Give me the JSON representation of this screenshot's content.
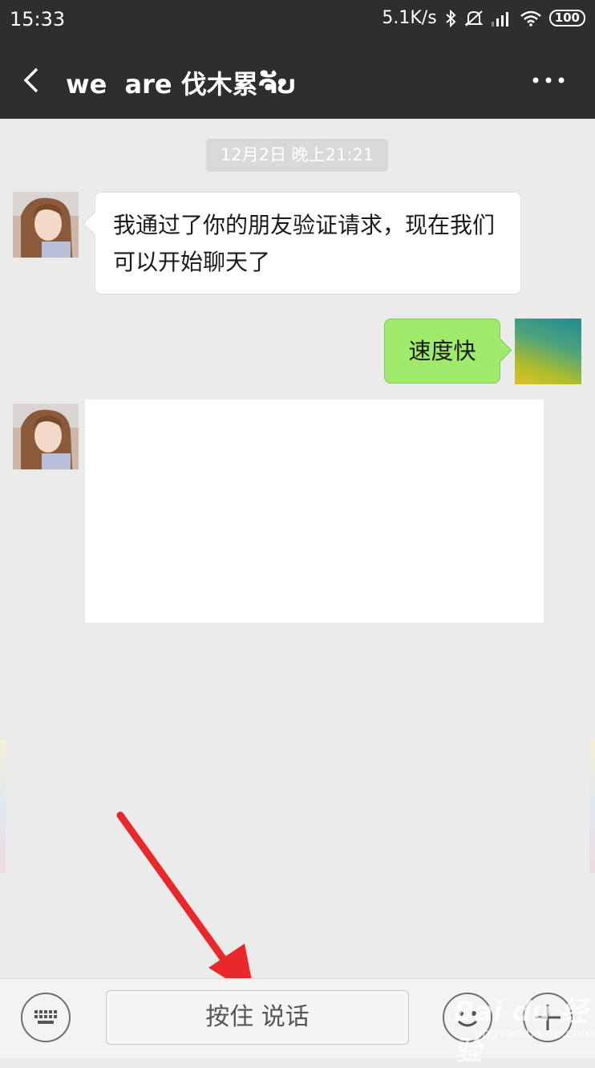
{
  "status_bar": {
    "time": "15:33",
    "network_speed": "5.1K/s",
    "battery": "100",
    "icons": [
      "bluetooth-icon",
      "mute-icon",
      "signal-icon",
      "wifi-icon",
      "battery-icon"
    ]
  },
  "header": {
    "title": "we  are 伐木累ຈັບ",
    "back_icon": "back-chevron-icon",
    "more_icon": "more-dots-icon"
  },
  "messages": {
    "timestamp": "12月2日 晚上21:21",
    "incoming_text": "我通过了你的朋友验证请求，现在我们可以开始聊天了",
    "outgoing_text": "速度快"
  },
  "input_bar": {
    "hold_to_talk_label": "按住 说话",
    "keyboard_icon": "keyboard-icon",
    "emoji_icon": "emoji-icon",
    "plus_icon": "plus-icon"
  },
  "watermark": {
    "brand": "Bai du 经验",
    "url": "jingyan.baidu.com"
  },
  "colors": {
    "header_bg": "#2e2e2e",
    "chat_bg": "#ebebeb",
    "outgoing_bubble": "#9eea6a",
    "annotation_arrow": "#e8282a"
  }
}
